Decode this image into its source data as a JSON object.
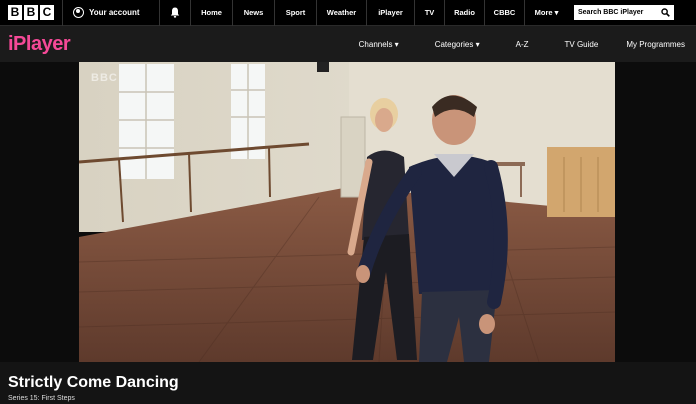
{
  "topbar": {
    "logo_letters": [
      "B",
      "B",
      "C"
    ],
    "account_label": "Your account",
    "nav": [
      "Home",
      "News",
      "Sport",
      "Weather",
      "iPlayer",
      "TV",
      "Radio",
      "CBBC",
      "More ▾"
    ],
    "search_placeholder": "Search BBC iPlayer"
  },
  "iplayer": {
    "logo": "iPlayer",
    "nav": [
      "Channels ▾",
      "Categories ▾",
      "A-Z",
      "TV Guide",
      "My Programmes"
    ]
  },
  "video": {
    "watermark": "BBC"
  },
  "programme": {
    "title": "Strictly Come Dancing",
    "subtitle": "Series 15: First Steps"
  },
  "colors": {
    "iplayer_pink": "#f54997",
    "bar_black": "#000000",
    "page_bg": "#141414"
  }
}
